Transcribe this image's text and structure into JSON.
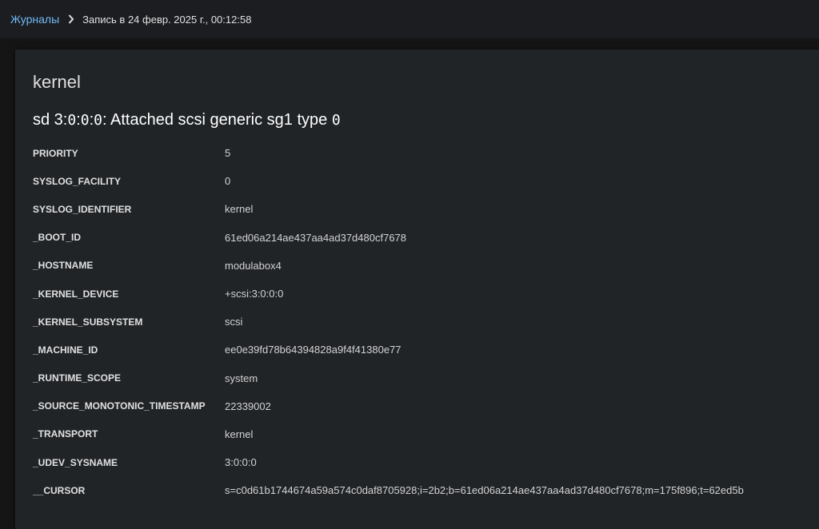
{
  "breadcrumb": {
    "parent": "Журналы",
    "current": "Запись в 24 февр. 2025 г., 00:12:58"
  },
  "entry": {
    "title": "kernel",
    "message_parts": [
      "sd 3:",
      "0",
      ":",
      "0",
      ":",
      "0",
      ": Attached scsi generic sg1 type ",
      "0"
    ],
    "fields": [
      {
        "key": "PRIORITY",
        "value": "5"
      },
      {
        "key": "SYSLOG_FACILITY",
        "value": "0"
      },
      {
        "key": "SYSLOG_IDENTIFIER",
        "value": "kernel"
      },
      {
        "key": "_BOOT_ID",
        "value": "61ed06a214ae437aa4ad37d480cf7678"
      },
      {
        "key": "_HOSTNAME",
        "value": "modulabox4"
      },
      {
        "key": "_KERNEL_DEVICE",
        "value": "+scsi:3:0:0:0"
      },
      {
        "key": "_KERNEL_SUBSYSTEM",
        "value": "scsi"
      },
      {
        "key": "_MACHINE_ID",
        "value": "ee0e39fd78b64394828a9f4f41380e77"
      },
      {
        "key": "_RUNTIME_SCOPE",
        "value": "system"
      },
      {
        "key": "_SOURCE_MONOTONIC_TIMESTAMP",
        "value": "22339002"
      },
      {
        "key": "_TRANSPORT",
        "value": "kernel"
      },
      {
        "key": "_UDEV_SYSNAME",
        "value": "3:0:0:0"
      },
      {
        "key": "__CURSOR",
        "value": "s=c0d61b1744674a59a574c0daf8705928;i=2b2;b=61ed06a214ae437aa4ad37d480cf7678;m=175f896;t=62ed5b"
      }
    ]
  },
  "colors": {
    "link": "#73bcf7",
    "background": "#151515",
    "card": "#212427"
  },
  "icons": {
    "separator": "chevron-right-icon"
  }
}
